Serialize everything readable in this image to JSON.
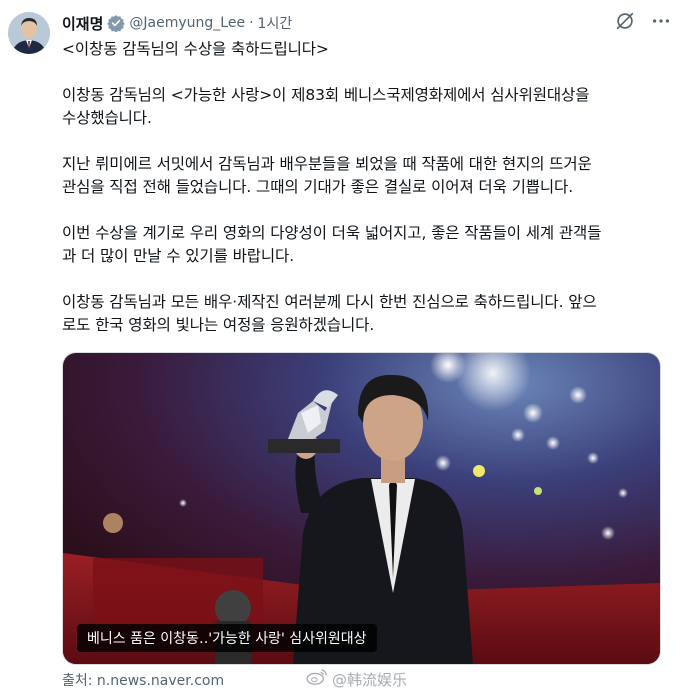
{
  "author": {
    "display_name": "이재명",
    "handle": "@Jaemyung_Lee",
    "separator": "·",
    "time": "1시간"
  },
  "post": {
    "paragraphs": [
      "<이창동 감독님의 수상을 축하드립니다>",
      "이창동 감독님의 <가능한 사랑>이 제83회 베니스국제영화제에서 심사위원대상을\n수상했습니다.",
      "지난 뤼미에르 서밋에서 감독님과 배우분들을 뵈었을 때 작품에 대한 현지의 뜨거운\n관심을 직접 전해 들었습니다. 그때의 기대가 좋은 결실로 이어져 더욱 기쁩니다.",
      "이번 수상을 계기로 우리 영화의 다양성이 더욱 넓어지고, 좋은 작품들이 세계 관객들\n과 더 많이 만날 수 있기를 바랍니다.",
      "이창동 감독님과 모든 배우·제작진 여러분께 다시 한번 진심으로 축하드립니다. 앞으\n로도 한국 영화의 빛나는 여정을 응원하겠습니다."
    ]
  },
  "media": {
    "caption": "베니스 품은 이창동‥'가능한 사랑' 심사위원대상"
  },
  "source": "출처: n.news.naver.com",
  "watermark": "@韩流娱乐",
  "icons": {
    "verified": "verified-badge-icon",
    "grok": "grok-icon",
    "more": "more-options-icon",
    "weibo": "weibo-logo-icon"
  },
  "colors": {
    "text": "#0f1419",
    "secondary": "#536471",
    "verified": "#829aab"
  }
}
